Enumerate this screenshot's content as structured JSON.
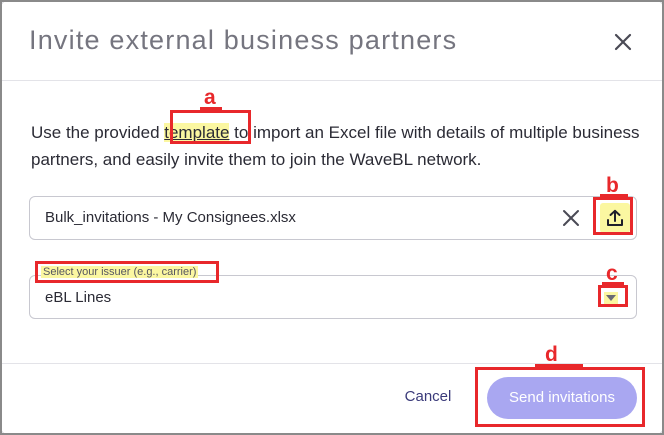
{
  "dialog": {
    "title": "Invite external business partners",
    "close_icon": "close-icon"
  },
  "description": {
    "before": "Use the provided ",
    "link": "template",
    "after": " to import an Excel file with details of multiple business partners, and easily invite them to join the WaveBL network."
  },
  "file_field": {
    "value": "Bulk_invitations - My Consignees.xlsx",
    "clear_icon": "clear-icon",
    "upload_icon": "upload-icon"
  },
  "issuer_select": {
    "label": "Select your issuer (e.g., carrier)",
    "value": "eBL Lines",
    "chevron_icon": "chevron-down-icon"
  },
  "footer": {
    "cancel_label": "Cancel",
    "send_label": "Send invitations"
  },
  "callouts": {
    "a": "a",
    "b": "b",
    "c": "c",
    "d": "d"
  },
  "colors": {
    "highlight": "#fbf7a1",
    "callout": "#e8282b",
    "primary_button": "#a9a7f1",
    "title_text": "#75757f"
  }
}
